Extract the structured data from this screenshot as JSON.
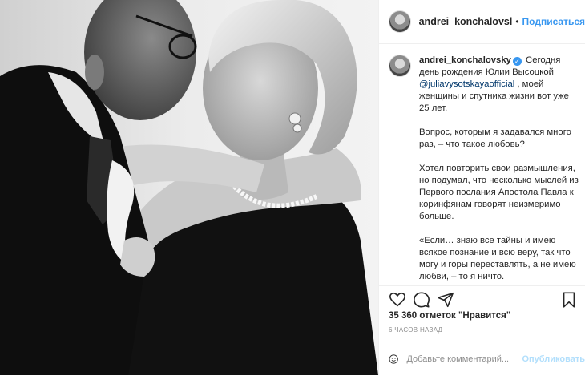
{
  "post": {
    "photo_icon": "portrait-photo",
    "author": {
      "username": "andrei_konchalovsl",
      "separator": "•",
      "follow_label": "Подписаться"
    },
    "caption": {
      "username": "andrei_konchalovsky",
      "verified_icon": "verified-badge-icon",
      "text_intro": "Сегодня день рождения Юлии Высоцкой",
      "mention": "@juliavysotskayaofficial",
      "text_after_mention": ", моей женщины и спутника жизни вот уже 25 лет.",
      "paragraphs": [
        "Вопрос, которым я задавался много раз, – что такое любовь?",
        "Хотел повторить свои размышления, но подумал, что несколько мыслей из Первого послания Апостола Павла к коринфянам говорят неизмеримо больше.",
        "«Если… знаю все тайны и имею всякое познание и всю веру, так что могу и горы переставлять, а не имею любви, – то я ничто."
      ]
    },
    "actions": {
      "like_icon": "heart-icon",
      "comment_icon": "comment-icon",
      "share_icon": "share-icon",
      "save_icon": "bookmark-icon"
    },
    "likes_text": "35 360 отметок \"Нравится\"",
    "time_ago": "6 ЧАСОВ НАЗАД",
    "comment": {
      "emoji_icon": "smiley-icon",
      "placeholder": "Добавьте комментарий...",
      "publish_label": "Опубликовать"
    },
    "colors": {
      "link": "#3897f0",
      "mention": "#00376b",
      "publish_disabled": "#b2dffc",
      "muted": "#8e8e8e",
      "text": "#262626"
    }
  }
}
